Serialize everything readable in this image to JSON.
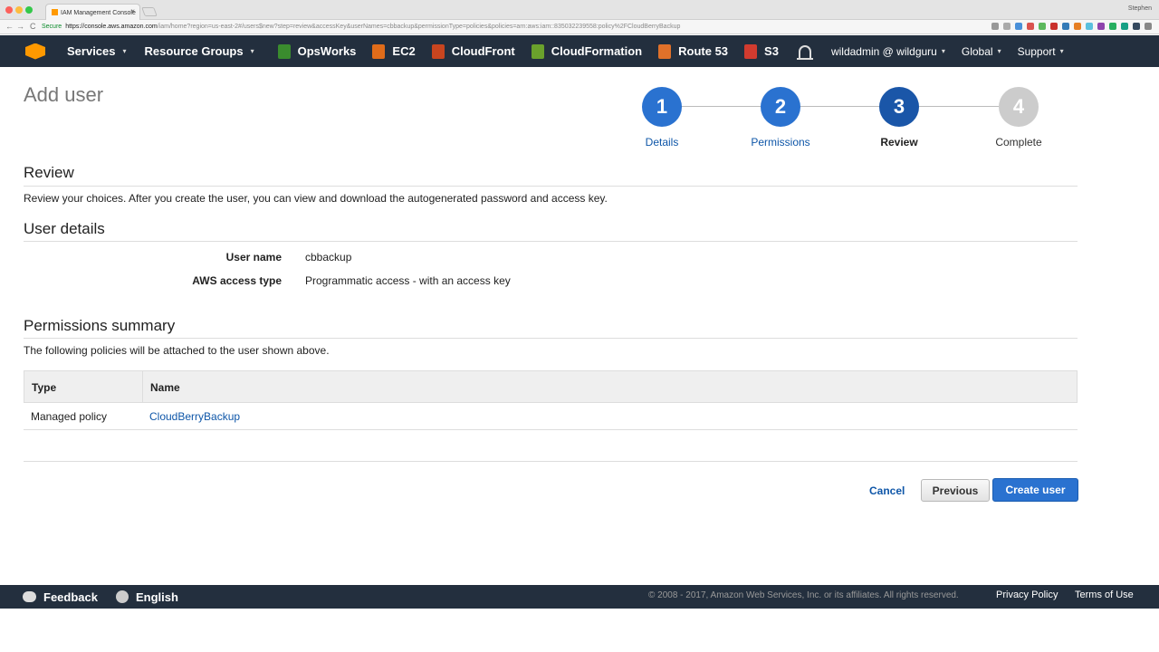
{
  "browser": {
    "tab_title": "IAM Management Console",
    "tab_close": "×",
    "profile_name": "Stephen",
    "back": "←",
    "forward": "→",
    "reload": "C",
    "secure_label": "Secure",
    "url_host": "https://console.aws.amazon.com",
    "url_path": "/iam/home?region=us-east-2#/users$new?step=review&accessKey&userNames=cbbackup&permissionType=policies&policies=arn:aws:iam::835032239558:policy%2FCloudBerryBackup"
  },
  "awsnav": {
    "services": "Services",
    "resource_groups": "Resource Groups",
    "caret": "▾",
    "shortcuts": [
      {
        "label": "OpsWorks",
        "color": "#3a8c2e"
      },
      {
        "label": "EC2",
        "color": "#e06c1a"
      },
      {
        "label": "CloudFront",
        "color": "#c8451f"
      },
      {
        "label": "CloudFormation",
        "color": "#6aa12c"
      },
      {
        "label": "Route 53",
        "color": "#e0712a"
      },
      {
        "label": "S3",
        "color": "#d13b2f"
      }
    ],
    "account": "wildadmin @ wildguru",
    "region": "Global",
    "support": "Support"
  },
  "page": {
    "title": "Add user",
    "steps": [
      {
        "number": "1",
        "label": "Details",
        "state": "done"
      },
      {
        "number": "2",
        "label": "Permissions",
        "state": "done"
      },
      {
        "number": "3",
        "label": "Review",
        "state": "current"
      },
      {
        "number": "4",
        "label": "Complete",
        "state": "pending"
      }
    ],
    "review_heading": "Review",
    "review_desc": "Review your choices. After you create the user, you can view and download the autogenerated password and access key.",
    "user_details_heading": "User details",
    "user_name_label": "User name",
    "user_name_value": "cbbackup",
    "access_type_label": "AWS access type",
    "access_type_value": "Programmatic access - with an access key",
    "permissions_heading": "Permissions summary",
    "permissions_desc": "The following policies will be attached to the user shown above.",
    "table": {
      "headers": [
        "Type",
        "Name"
      ],
      "rows": [
        {
          "type": "Managed policy",
          "name": "CloudBerryBackup"
        }
      ]
    },
    "buttons": {
      "cancel": "Cancel",
      "previous": "Previous",
      "create": "Create user"
    }
  },
  "footer": {
    "feedback": "Feedback",
    "language": "English",
    "copyright": "© 2008 - 2017, Amazon Web Services, Inc. or its affiliates. All rights reserved.",
    "privacy": "Privacy Policy",
    "terms": "Terms of Use"
  },
  "colors": {
    "step_done": "#2a72d0",
    "step_current": "#1a56a8",
    "step_pending": "#cccccc",
    "nav_bg": "#232f3e",
    "primary": "#2a72d0",
    "link": "#0e56a8"
  }
}
